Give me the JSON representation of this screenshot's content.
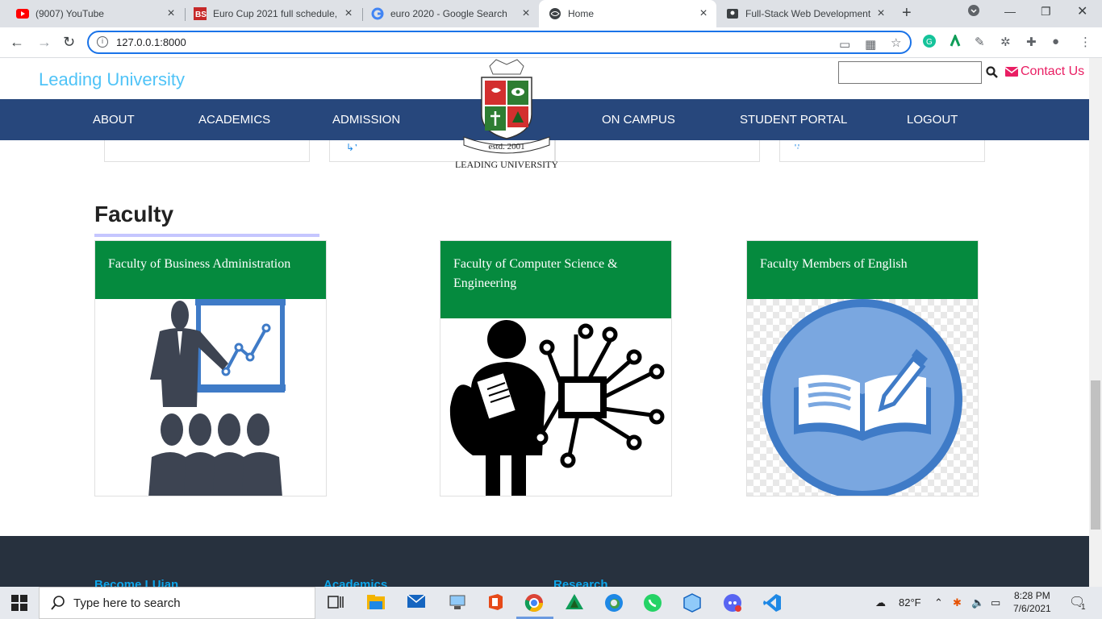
{
  "browser": {
    "tabs": [
      {
        "title": "(9007) YouTube",
        "icon": "youtube-icon"
      },
      {
        "title": "Euro Cup 2021 full schedule, ",
        "icon": "bs-icon"
      },
      {
        "title": "euro 2020 - Google Search",
        "icon": "google-icon"
      },
      {
        "title": "Home",
        "icon": "globe-icon"
      },
      {
        "title": "Full-Stack Web Development",
        "icon": "course-icon"
      }
    ],
    "url": "127.0.0.1:8000"
  },
  "site": {
    "brand": "Leading University",
    "contact": "Contact Us",
    "search_placeholder": "",
    "nav": [
      "ABOUT",
      "ACADEMICS",
      "ADMISSION",
      "ON CAMPUS",
      "STUDENT PORTAL",
      "LOGOUT"
    ],
    "logo_estd": "estd. 2001",
    "logo_text": "LEADING UNIVERSITY",
    "faculty_heading": "Faculty",
    "faculties": [
      {
        "title": "Faculty of Business Administration",
        "image": "business-presentation-icon"
      },
      {
        "title": "Faculty of Computer Science & Engineering",
        "image": "computer-science-icon"
      },
      {
        "title": "Faculty Members of English",
        "image": "open-book-icon"
      }
    ],
    "footer": [
      "Become LUian",
      "Academics",
      "Research"
    ]
  },
  "taskbar": {
    "search_placeholder": "Type here to search",
    "weather": "82°F",
    "time": "8:28 PM",
    "date": "7/6/2021",
    "notification_count": "1"
  },
  "colors": {
    "nav_bg": "#27477c",
    "card_header": "#058a3e",
    "brand": "#4fc3f7",
    "contact": "#e91e63",
    "footer_bg": "#27313e"
  }
}
